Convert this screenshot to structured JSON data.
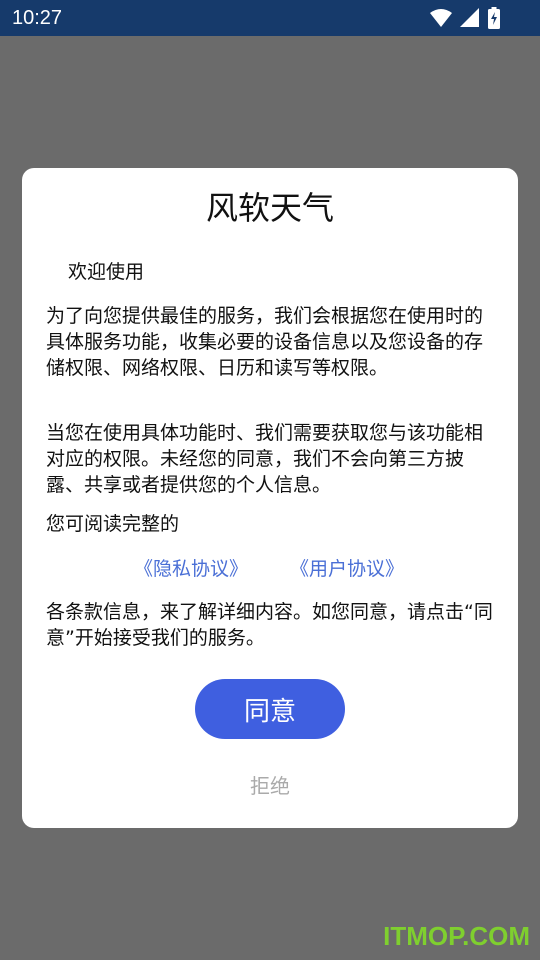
{
  "status_bar": {
    "time": "10:27",
    "icons": [
      "wifi-icon",
      "signal-icon",
      "battery-charging-icon"
    ],
    "background": "#163a6b"
  },
  "dialog": {
    "title": "风软天气",
    "welcome": "欢迎使用",
    "paragraph1": "为了向您提供最佳的服务，我们会根据您在使用时的具体服务功能，收集必要的设备信息以及您设备的存储权限、网络权限、日历和读写等权限。",
    "paragraph2": "当您在使用具体功能时、我们需要获取您与该功能相对应的权限。未经您的同意，我们不会向第三方披露、共享或者提供您的个人信息。",
    "paragraph3": "您可阅读完整的",
    "privacy_link": "《隐私协议》",
    "user_link": "《用户协议》",
    "paragraph4": "各条款信息，来了解详细内容。如您同意，请点击“同意”开始接受我们的服务。",
    "agree_label": "同意",
    "reject_label": "拒绝"
  },
  "watermark": "ITMOP.COM",
  "colors": {
    "overlay": "#6b6b6b",
    "accent": "#3f5fe0",
    "link": "#4a6fd6",
    "watermark": "#7fcf2f"
  }
}
